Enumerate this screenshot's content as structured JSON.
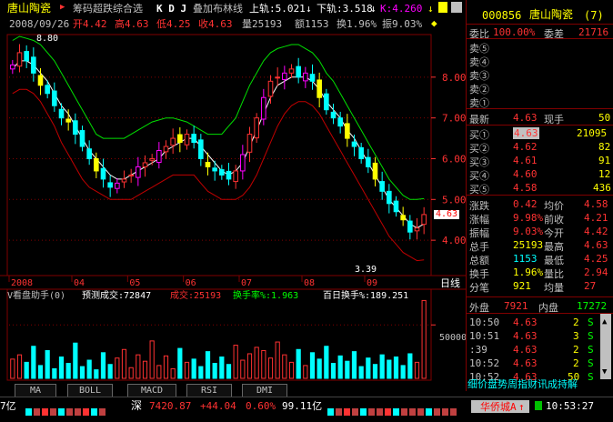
{
  "header": {
    "stock_name": "唐山陶瓷",
    "indicator_label": "筹码超跌综合选",
    "kdj": "K D J",
    "overlay": "叠加布林线",
    "up_label": "上轨:5.021",
    "down_label": "下轨:3.518",
    "k_label": "K:4.260",
    "date": "2008/09/26",
    "open": "开4.42",
    "high": "高4.63",
    "low": "低4.25",
    "close": "收4.63",
    "volume": "量25193",
    "amount": "额1153",
    "turnover": "换1.96%",
    "amplitude": "振9.03%"
  },
  "price_axis": [
    "8.00",
    "7.00",
    "6.00",
    "5.00",
    "4.00"
  ],
  "current_price_tag": "4.63",
  "high_mark": "8.80",
  "low_mark": "3.39",
  "time_axis": [
    "2008",
    "04",
    "05",
    "06",
    "07",
    "08",
    "09"
  ],
  "period_label": "日线",
  "volume_header": {
    "title": "V看盘助手(0)",
    "forecast": "预测成交:72847",
    "deal": "成交:25193",
    "rate": "换手率%:1.963",
    "hundred": "百日换手%:189.251"
  },
  "volume_axis": "50000",
  "tabs": [
    "MA",
    "BOLL",
    "MACD",
    "RSI",
    "DMI"
  ],
  "panel": {
    "code": "000856",
    "name": "唐山陶瓷",
    "count": "(7)",
    "weibi_label": "委比",
    "weibi": "100.00%",
    "weicha_label": "委差",
    "weicha": "21716",
    "sells": [
      {
        "label": "卖⑤",
        "price": "",
        "vol": ""
      },
      {
        "label": "卖④",
        "price": "",
        "vol": ""
      },
      {
        "label": "卖③",
        "price": "",
        "vol": ""
      },
      {
        "label": "卖②",
        "price": "",
        "vol": ""
      },
      {
        "label": "卖①",
        "price": "",
        "vol": ""
      }
    ],
    "latest_label": "最新",
    "latest": "4.63",
    "now_label": "现手",
    "now": "50",
    "buys": [
      {
        "label": "买①",
        "price": "4.63",
        "vol": "21095"
      },
      {
        "label": "买②",
        "price": "4.62",
        "vol": "82"
      },
      {
        "label": "买③",
        "price": "4.61",
        "vol": "91"
      },
      {
        "label": "买④",
        "price": "4.60",
        "vol": "12"
      },
      {
        "label": "买⑤",
        "price": "4.58",
        "vol": "436"
      }
    ],
    "stats": [
      {
        "l1": "涨跌",
        "v1": "0.42",
        "l2": "均价",
        "v2": "4.58"
      },
      {
        "l1": "涨幅",
        "v1": "9.98%",
        "l2": "前收",
        "v2": "4.21"
      },
      {
        "l1": "振幅",
        "v1": "9.03%",
        "l2": "今开",
        "v2": "4.42"
      },
      {
        "l1": "总手",
        "v1": "25193",
        "l2": "最高",
        "v2": "4.63"
      },
      {
        "l1": "总额",
        "v1": "1153",
        "l2": "最低",
        "v2": "4.25"
      },
      {
        "l1": "换手",
        "v1": "1.96%",
        "l2": "量比",
        "v2": "2.94"
      },
      {
        "l1": "分笔",
        "v1": "921",
        "l2": "均量",
        "v2": "27"
      }
    ],
    "outer_label": "外盘",
    "outer": "7921",
    "inner_label": "内盘",
    "inner": "17272",
    "ticks": [
      {
        "time": "10:50",
        "price": "4.63",
        "vol": "2",
        "bs": "S"
      },
      {
        "time": "10:51",
        "price": "4.63",
        "vol": "3",
        "bs": "S"
      },
      {
        "time": ":39",
        "price": "4.63",
        "vol": "2",
        "bs": "S"
      },
      {
        "time": "10:52",
        "price": "4.63",
        "vol": "2",
        "bs": "S"
      },
      {
        "time": "10:52",
        "price": "4.63",
        "vol": "50",
        "bs": "S"
      }
    ],
    "bottom_tabs": "细价盘势周指财讯成持解"
  },
  "status": {
    "left_amount": "7亿",
    "sz_label": "深",
    "sz_index": "7420.87",
    "sz_change": "+44.04",
    "sz_pct": "0.60%",
    "sz_amount": "99.11亿",
    "broker": "华侨城A",
    "broker_arrow": "↑",
    "clock": "10:53:27"
  },
  "colors": {
    "up": "#ff3232",
    "down": "#00ffff",
    "yellow": "#ffff00",
    "magenta": "#ff00ff",
    "green": "#00e000",
    "white": "#ffffff",
    "grid": "#800000",
    "label": "#c0c0c0"
  },
  "chart_data": {
    "type": "candlestick",
    "ylim": [
      3.2,
      9.0
    ],
    "days": 60,
    "closes": [
      8.3,
      8.6,
      8.4,
      8.1,
      7.8,
      7.6,
      7.3,
      7.0,
      6.9,
      6.6,
      6.3,
      6.0,
      5.7,
      5.5,
      5.3,
      5.4,
      5.5,
      5.6,
      5.8,
      5.9,
      6.0,
      6.2,
      6.3,
      6.5,
      6.4,
      6.6,
      6.4,
      6.0,
      5.8,
      5.7,
      5.6,
      5.5,
      5.7,
      6.1,
      6.6,
      7.0,
      7.5,
      7.9,
      8.0,
      8.1,
      8.2,
      8.0,
      8.1,
      7.9,
      7.5,
      7.2,
      7.0,
      6.8,
      6.5,
      6.3,
      6.0,
      5.8,
      5.5,
      5.2,
      4.9,
      4.7,
      4.5,
      4.2,
      4.3,
      4.63
    ],
    "upper_band": [
      8.9,
      9.0,
      8.95,
      8.9,
      8.8,
      8.6,
      8.4,
      8.1,
      7.8,
      7.5,
      7.2,
      6.9,
      6.6,
      6.5,
      6.5,
      6.5,
      6.5,
      6.6,
      6.7,
      6.8,
      6.9,
      6.95,
      7.0,
      7.0,
      6.95,
      6.9,
      6.8,
      6.7,
      6.6,
      6.6,
      6.6,
      6.8,
      7.0,
      7.4,
      7.8,
      8.1,
      8.4,
      8.6,
      8.7,
      8.75,
      8.8,
      8.8,
      8.7,
      8.6,
      8.4,
      8.1,
      7.9,
      7.6,
      7.3,
      7.0,
      6.7,
      6.4,
      6.1,
      5.8,
      5.5,
      5.3,
      5.1,
      5.0,
      5.0,
      5.02
    ],
    "mid_line": [
      8.2,
      8.4,
      8.4,
      8.3,
      8.1,
      7.9,
      7.6,
      7.3,
      7.1,
      6.8,
      6.5,
      6.2,
      6.0,
      5.8,
      5.6,
      5.5,
      5.5,
      5.6,
      5.7,
      5.8,
      5.9,
      6.0,
      6.2,
      6.3,
      6.4,
      6.5,
      6.5,
      6.3,
      6.1,
      5.9,
      5.7,
      5.6,
      5.7,
      5.9,
      6.3,
      6.7,
      7.1,
      7.5,
      7.8,
      7.9,
      8.0,
      8.0,
      8.0,
      7.9,
      7.7,
      7.4,
      7.2,
      7.0,
      6.7,
      6.5,
      6.2,
      5.9,
      5.6,
      5.3,
      5.0,
      4.8,
      4.6,
      4.4,
      4.3,
      4.4
    ],
    "lower_band": [
      7.6,
      7.7,
      7.7,
      7.6,
      7.4,
      7.1,
      6.8,
      6.4,
      6.1,
      5.8,
      5.5,
      5.3,
      5.2,
      5.1,
      5.0,
      5.0,
      5.0,
      5.0,
      5.1,
      5.2,
      5.3,
      5.4,
      5.5,
      5.6,
      5.6,
      5.6,
      5.6,
      5.4,
      5.2,
      5.1,
      5.0,
      5.0,
      5.0,
      5.1,
      5.3,
      5.6,
      6.0,
      6.4,
      6.8,
      7.1,
      7.3,
      7.4,
      7.4,
      7.3,
      7.1,
      6.8,
      6.5,
      6.2,
      5.9,
      5.6,
      5.3,
      5.0,
      4.7,
      4.4,
      4.1,
      3.9,
      3.7,
      3.6,
      3.5,
      3.52
    ],
    "volumes": [
      18000,
      22000,
      15000,
      30000,
      12000,
      26000,
      9000,
      20000,
      14000,
      33000,
      11000,
      17000,
      8000,
      24000,
      13000,
      19000,
      27000,
      10000,
      22000,
      16000,
      35000,
      12000,
      21000,
      9000,
      28000,
      15000,
      18000,
      11000,
      25000,
      14000,
      20000,
      13000,
      31000,
      17000,
      23000,
      29000,
      26000,
      19000,
      34000,
      22000,
      15000,
      27000,
      12000,
      24000,
      18000,
      30000,
      14000,
      21000,
      16000,
      25000,
      11000,
      19000,
      13000,
      22000,
      17000,
      20000,
      12000,
      23000,
      15000,
      72847
    ],
    "volume_ylim": [
      0,
      80000
    ]
  }
}
